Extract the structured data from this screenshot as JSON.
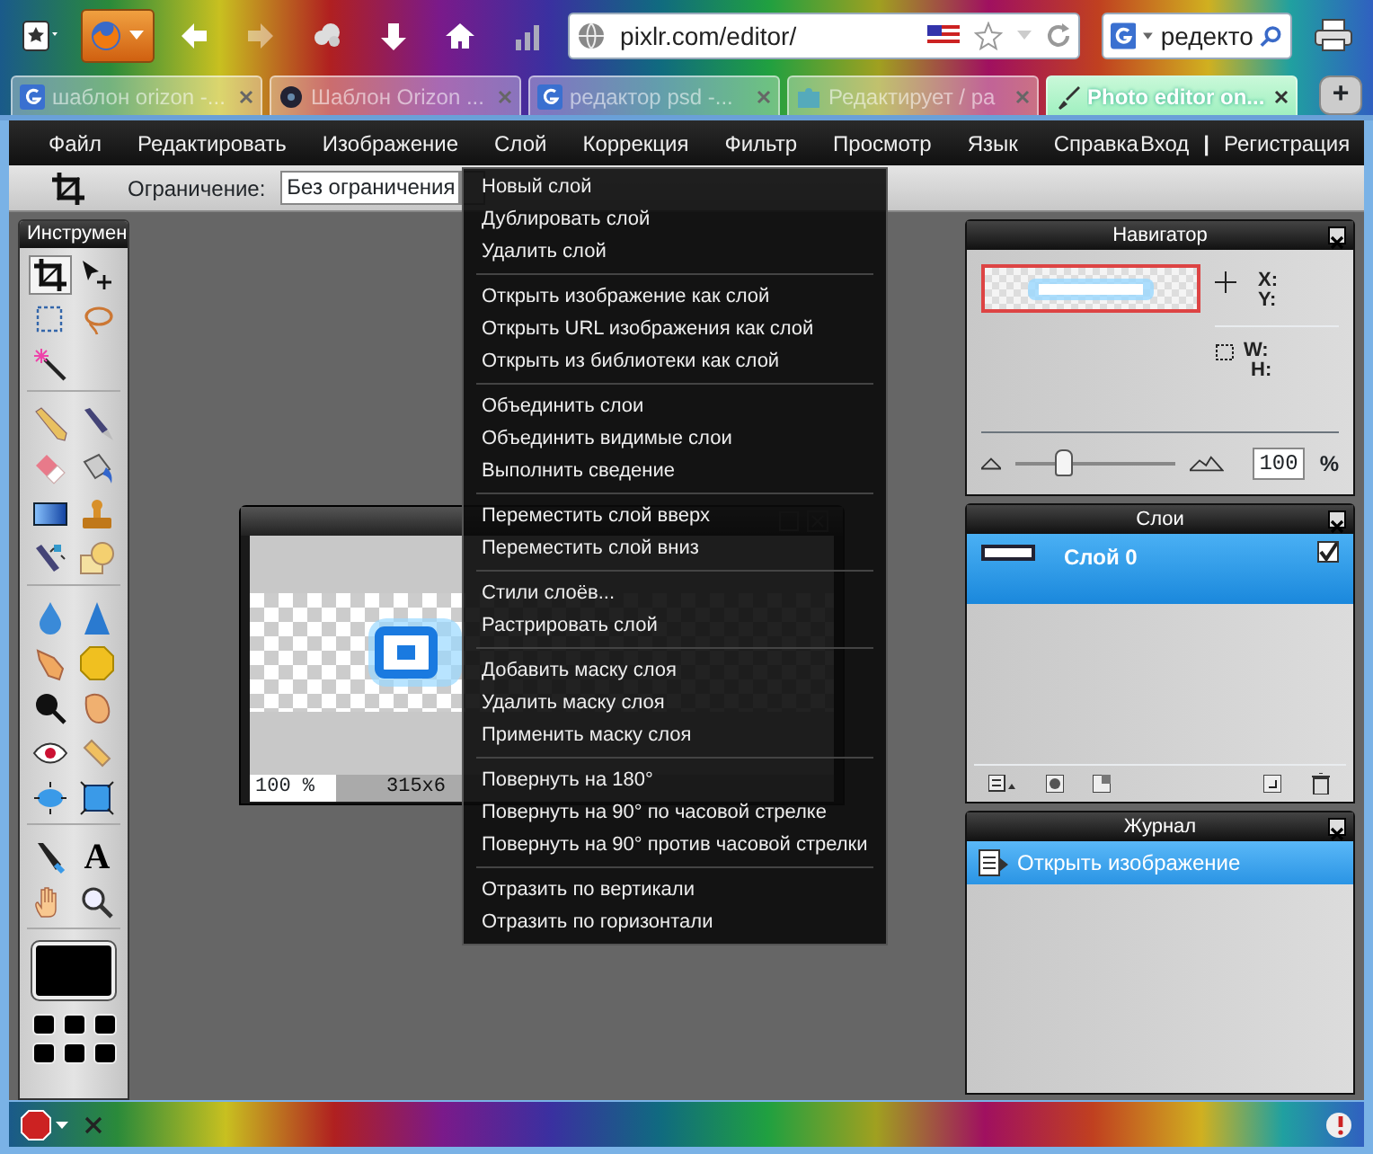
{
  "browser": {
    "url": "pixlr.com/editor/",
    "search": "редекто",
    "tabs": [
      {
        "label": "шаблон orizon -...",
        "selected": false,
        "kind": "search"
      },
      {
        "label": "Шаблон Orizon ...",
        "selected": false,
        "kind": "media"
      },
      {
        "label": "редактор psd -...",
        "selected": false,
        "kind": "search"
      },
      {
        "label": "Редактирует / ра",
        "selected": false,
        "kind": "puzzle"
      },
      {
        "label": "Photo editor on...",
        "selected": true,
        "kind": "brush"
      }
    ],
    "new_tab": "+"
  },
  "menu": {
    "items": [
      "Файл",
      "Редактировать",
      "Изображение",
      "Слой",
      "Коррекция",
      "Фильтр",
      "Просмотр",
      "Язык",
      "Справка"
    ],
    "login": "Вход",
    "divider": "|",
    "register": "Регистрация"
  },
  "options": {
    "constraint_label": "Ограничение:",
    "constraint_value": "Без ограничения"
  },
  "layer_menu": {
    "groups": [
      [
        "Новый слой",
        "Дублировать слой",
        "Удалить слой"
      ],
      [
        "Открыть изображение как слой",
        "Открыть URL изображения как слой",
        "Открыть из библиотеки как слой"
      ],
      [
        "Объединить слои",
        "Объединить видимые слои",
        "Выполнить сведение"
      ],
      [
        "Переместить слой вверх",
        "Переместить слой вниз"
      ],
      [
        "Стили слоёв...",
        "Растрировать слой"
      ],
      [
        "Добавить маску слоя",
        "Удалить маску слоя",
        "Применить маску слоя"
      ],
      [
        "Повернуть на 180°",
        "Повернуть на 90° по часовой стрелке",
        "Повернуть на 90° против часовой стрелки"
      ],
      [
        "Отразить по вертикали",
        "Отразить по горизонтали"
      ]
    ]
  },
  "tools": {
    "title": "Инструмен",
    "groups": [
      [
        {
          "kind": "crop",
          "selected": true
        },
        {
          "kind": "move",
          "selected": false
        },
        {
          "kind": "marquee",
          "selected": false
        },
        {
          "kind": "lasso",
          "selected": false
        },
        {
          "kind": "wand",
          "selected": false
        }
      ],
      [
        {
          "kind": "pencil",
          "selected": false
        },
        {
          "kind": "brush",
          "selected": false
        },
        {
          "kind": "eraser",
          "selected": false
        },
        {
          "kind": "bucket",
          "selected": false
        },
        {
          "kind": "gradient",
          "selected": false
        },
        {
          "kind": "stamp",
          "selected": false
        },
        {
          "kind": "replace",
          "selected": false
        },
        {
          "kind": "shapes",
          "selected": false
        }
      ],
      [
        {
          "kind": "blur",
          "selected": false
        },
        {
          "kind": "sharpen",
          "selected": false
        },
        {
          "kind": "smudge",
          "selected": false
        },
        {
          "kind": "sponge",
          "selected": false
        },
        {
          "kind": "burn",
          "selected": false
        },
        {
          "kind": "dodge",
          "selected": false
        },
        {
          "kind": "redeye",
          "selected": false
        },
        {
          "kind": "heal",
          "selected": false
        },
        {
          "kind": "bloat",
          "selected": false
        },
        {
          "kind": "pinch",
          "selected": false
        }
      ],
      [
        {
          "kind": "dropper",
          "selected": false
        },
        {
          "kind": "text",
          "selected": false,
          "label": "A"
        },
        {
          "kind": "hand",
          "selected": false
        },
        {
          "kind": "zoom",
          "selected": false
        }
      ]
    ]
  },
  "document": {
    "zoom": "100 %",
    "size": "315x6"
  },
  "navigator": {
    "title": "Навигатор",
    "x_label": "X:",
    "y_label": "Y:",
    "w_label": "W:",
    "h_label": "H:",
    "level": 0.3,
    "zoom_value": "100",
    "zoom_unit": "%"
  },
  "layers": {
    "title": "Слои",
    "items": [
      {
        "name": "Слой 0",
        "selected": true,
        "visible": true
      }
    ]
  },
  "history": {
    "title": "Журнал",
    "items": [
      {
        "label": "Открыть изображение",
        "selected": true
      }
    ]
  }
}
